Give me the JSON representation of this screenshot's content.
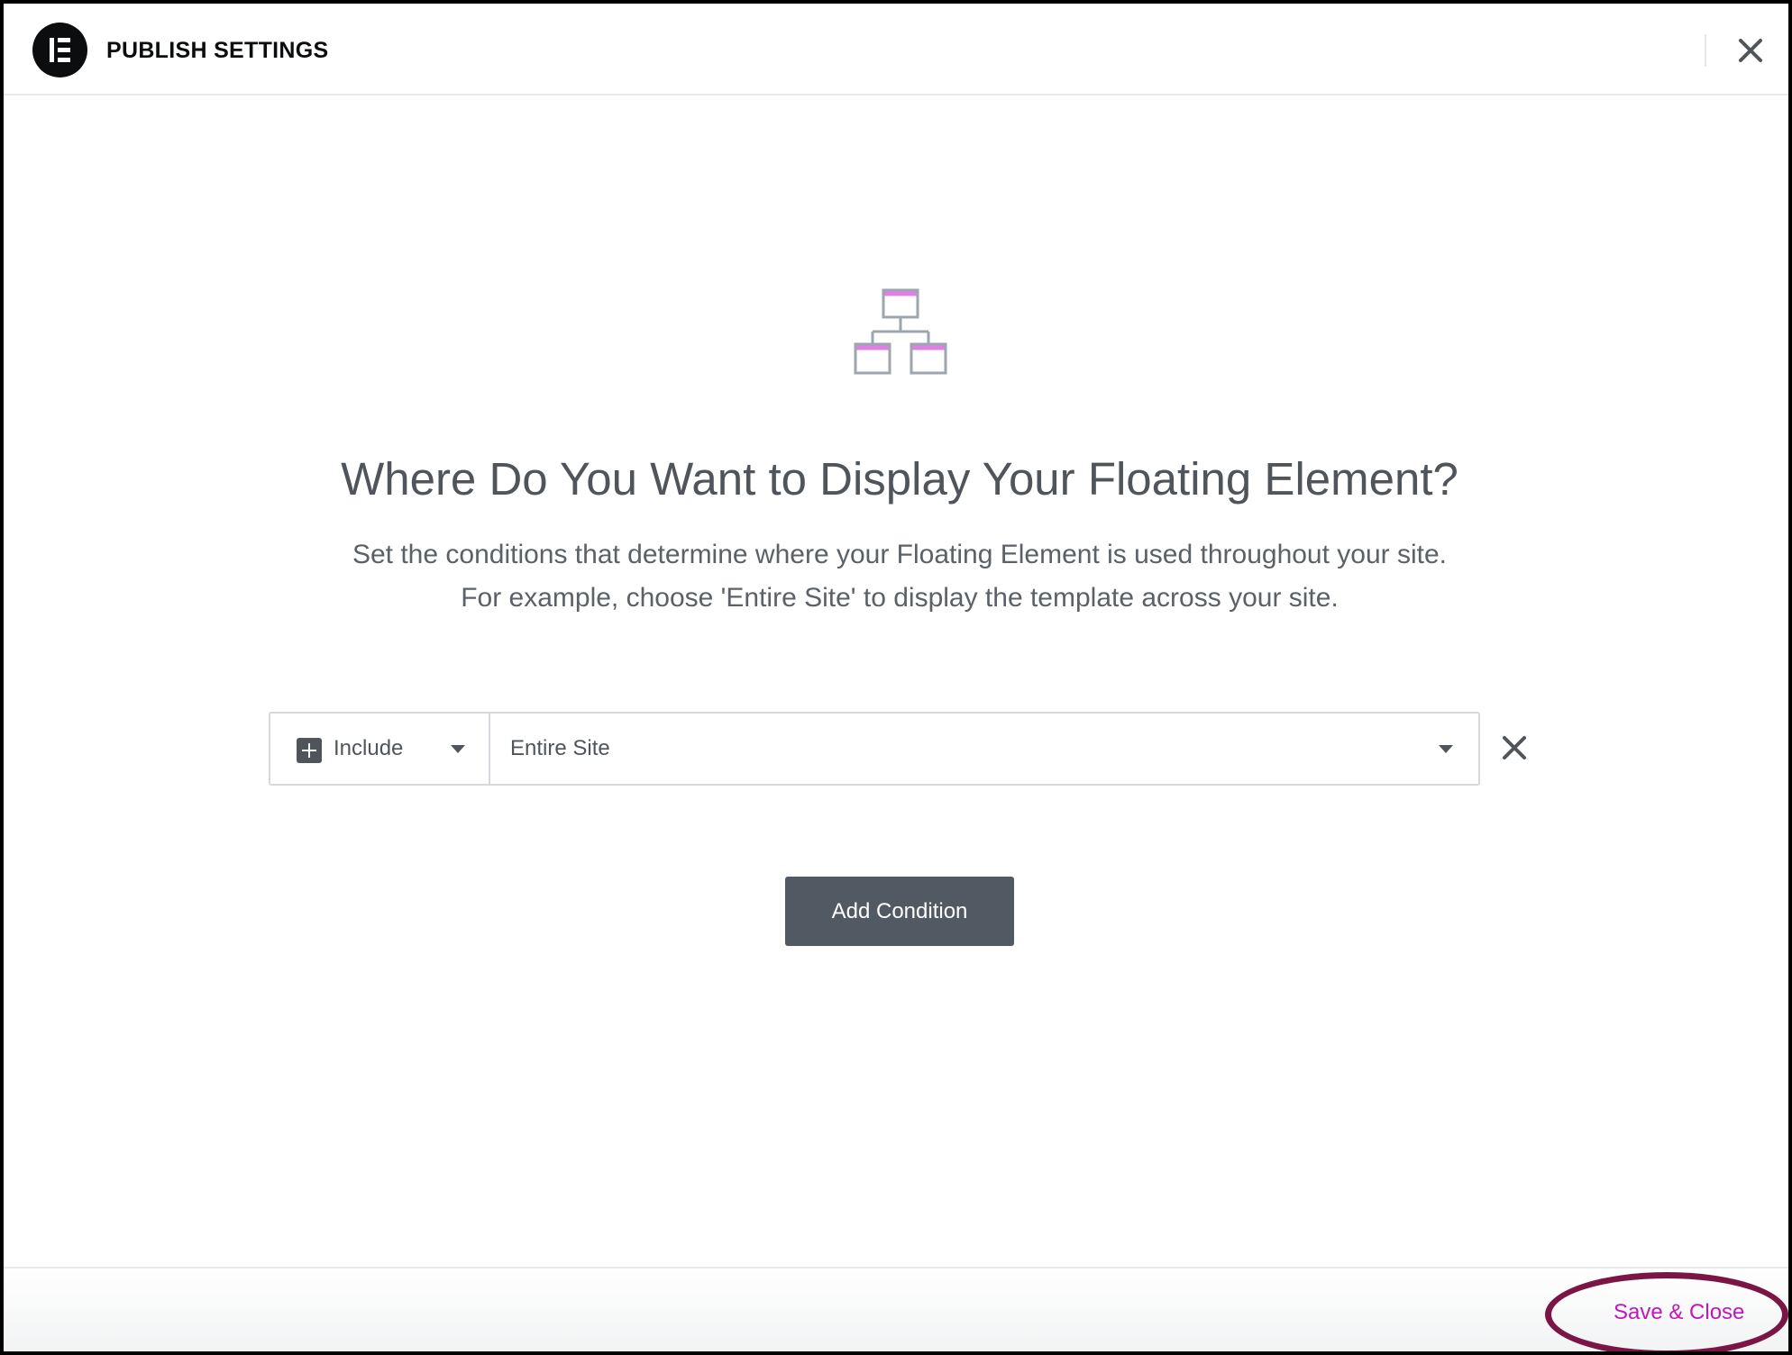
{
  "header": {
    "title": "PUBLISH SETTINGS",
    "logo_icon": "elementor-logo-icon",
    "close_icon": "close-icon"
  },
  "main": {
    "illustration_icon": "site-hierarchy-icon",
    "title": "Where Do You Want to Display Your Floating Element?",
    "description_line1": "Set the conditions that determine where your Floating Element is used throughout your site.",
    "description_line2": "For example, choose 'Entire Site' to display the template across your site."
  },
  "condition": {
    "type_selected": "Include",
    "scope_selected": "Entire Site",
    "type_icon": "plus-square-icon",
    "dropdown_icon": "caret-down-icon",
    "remove_icon": "close-icon"
  },
  "add_condition_label": "Add Condition",
  "footer": {
    "save_close_label": "Save & Close"
  },
  "colors": {
    "accent": "#c017c0",
    "highlight_ring": "#7a1545",
    "button_bg": "#515962",
    "text_primary": "#4f555b",
    "illustration_accent": "#e27ee7"
  }
}
